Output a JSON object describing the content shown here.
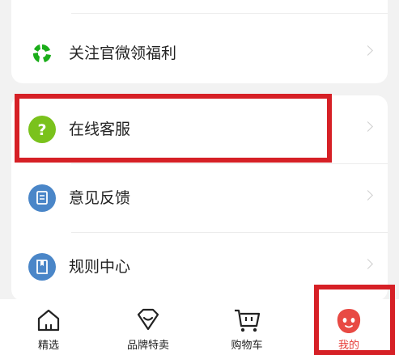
{
  "menu": {
    "top_items": [
      {
        "label": "关注官微领福利",
        "icon": "wechat-logo-icon",
        "color": "#1aad19"
      }
    ],
    "items": [
      {
        "label": "在线客服",
        "icon": "question-icon",
        "color": "#7ac21c"
      },
      {
        "label": "意见反馈",
        "icon": "feedback-icon",
        "color": "#4a86c8"
      },
      {
        "label": "规则中心",
        "icon": "book-icon",
        "color": "#4a86c8"
      }
    ]
  },
  "tabbar": {
    "tabs": [
      {
        "label": "精选",
        "icon": "home-icon"
      },
      {
        "label": "品牌特卖",
        "icon": "brand-heart-icon"
      },
      {
        "label": "购物车",
        "icon": "cart-icon"
      },
      {
        "label": "我的",
        "icon": "profile-face-icon",
        "active": true
      }
    ],
    "active_color": "#e63a36"
  },
  "highlight_color": "#d62026"
}
